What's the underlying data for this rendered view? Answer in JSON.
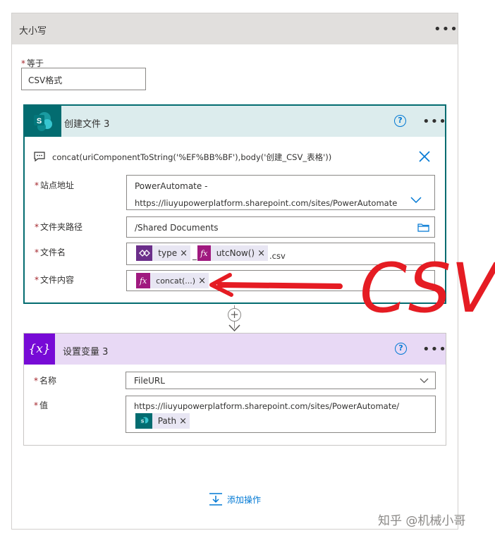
{
  "condition_block": {
    "title": "大小写",
    "equals_label": "等于",
    "equals_value": "CSV格式"
  },
  "create_file": {
    "title": "创建文件 3",
    "help": "?",
    "expression": "concat(uriComponentToString('%EF%BB%BF'),body('创建_CSV_表格'))",
    "site_label": "站点地址",
    "site_line1": "PowerAutomate -",
    "site_line2": "https://liuyupowerplatform.sharepoint.com/sites/PowerAutomate",
    "folder_label": "文件夹路径",
    "folder_value": "/Shared Documents",
    "filename_label": "文件名",
    "filename_token1": "type",
    "filename_sep": "_",
    "filename_token2": "utcNow()",
    "filename_suffix": ".csv",
    "content_label": "文件内容",
    "content_token": "concat(...)"
  },
  "set_variable": {
    "title": "设置变量 3",
    "help": "?",
    "name_label": "名称",
    "name_value": "FileURL",
    "value_label": "值",
    "value_text": "https://liuyupowerplatform.sharepoint.com/sites/PowerAutomate/",
    "value_token": "Path"
  },
  "add_action_label": "添加操作",
  "annotation_text": "CSV",
  "watermark": "知乎 @机械小哥",
  "colors": {
    "sharepoint": "#036c70",
    "variable": "#770bd6",
    "expression": "#a0197f",
    "annotation": "#e51c23",
    "link": "#0078d4"
  }
}
